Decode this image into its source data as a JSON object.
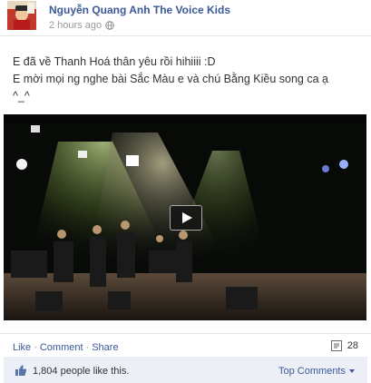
{
  "post": {
    "author_name": "Nguyễn Quang Anh The Voice Kids",
    "timestamp": "2 hours ago",
    "privacy_icon": "globe-icon",
    "text_lines": [
      "E đã về Thanh Hoá thân yêu rồi hihiiii :D",
      "E mời mọi ng nghe bài Sắc Màu e và chú Bằng Kiều song ca ạ",
      "^_^"
    ]
  },
  "video": {
    "play_icon": "play-icon"
  },
  "actions": {
    "like_label": "Like",
    "comment_label": "Comment",
    "share_label": "Share",
    "separator": "·",
    "share_count": "28",
    "share_count_icon": "shares-icon"
  },
  "likes_bar": {
    "thumb_icon": "thumbs-up-icon",
    "likes_text": "1,804 people like this.",
    "sort_label": "Top Comments"
  },
  "colors": {
    "link": "#3b5998",
    "muted": "#999999",
    "likes_bar_bg": "#eceff5"
  }
}
